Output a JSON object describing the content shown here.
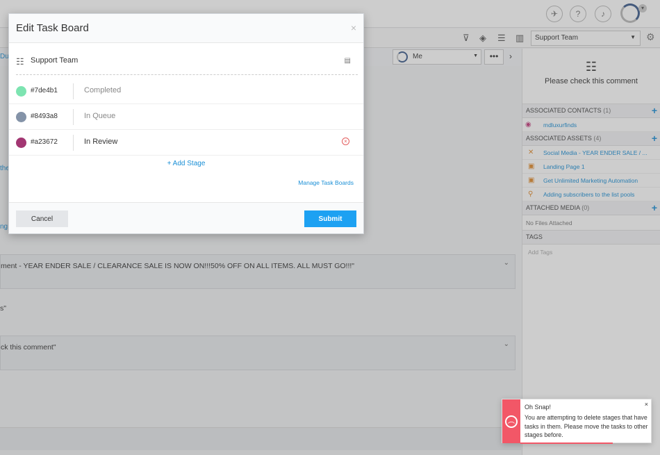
{
  "background": {
    "toolbar": {
      "team_select": "Support Team"
    },
    "subbar": {
      "left_link": "Du",
      "assignee": "Me",
      "more": "•••"
    },
    "main": {
      "side_link_1": "the",
      "side_link_2": "ng",
      "comment_1": "ment - YEAR ENDER SALE / CLEARANCE SALE IS NOW ON!!!50% OFF ON ALL ITEMS. ALL MUST GO!!!\"",
      "loose_text": "s\"",
      "comment_2": "ck this comment\""
    },
    "right_panel": {
      "title": "Please check this comment",
      "contacts_label": "ASSOCIATED CONTACTS",
      "contacts_count": "(1)",
      "contact": "mdluxurfinds",
      "assets_label": "ASSOCIATED ASSETS",
      "assets_count": "(4)",
      "assets": [
        "Social Media - YEAR ENDER SALE / ...",
        "Landing Page 1",
        "Get Unlimited Marketing Automation",
        "Adding subscribers to the list pools"
      ],
      "media_label": "ATTACHED MEDIA",
      "media_count": "(0)",
      "media_empty": "No Files Attached",
      "tags_label": "TAGS",
      "tags_placeholder": "Add Tags"
    }
  },
  "modal": {
    "title": "Edit Task Board",
    "close": "×",
    "board_name": "Support Team",
    "stages": [
      {
        "color": "#7de4b1",
        "name": "Completed",
        "active": false
      },
      {
        "color": "#8493a8",
        "name": "In Queue",
        "active": false
      },
      {
        "color": "#a23672",
        "name": "In Review",
        "active": true
      }
    ],
    "add_stage": "+ Add Stage",
    "manage_link": "Manage Task Boards",
    "cancel_label": "Cancel",
    "submit_label": "Submit"
  },
  "toast": {
    "title": "Oh Snap!",
    "message": "You are attempting to delete stages that have tasks in them. Please move the tasks to other stages before.",
    "close": "×",
    "progress": 0.7
  }
}
